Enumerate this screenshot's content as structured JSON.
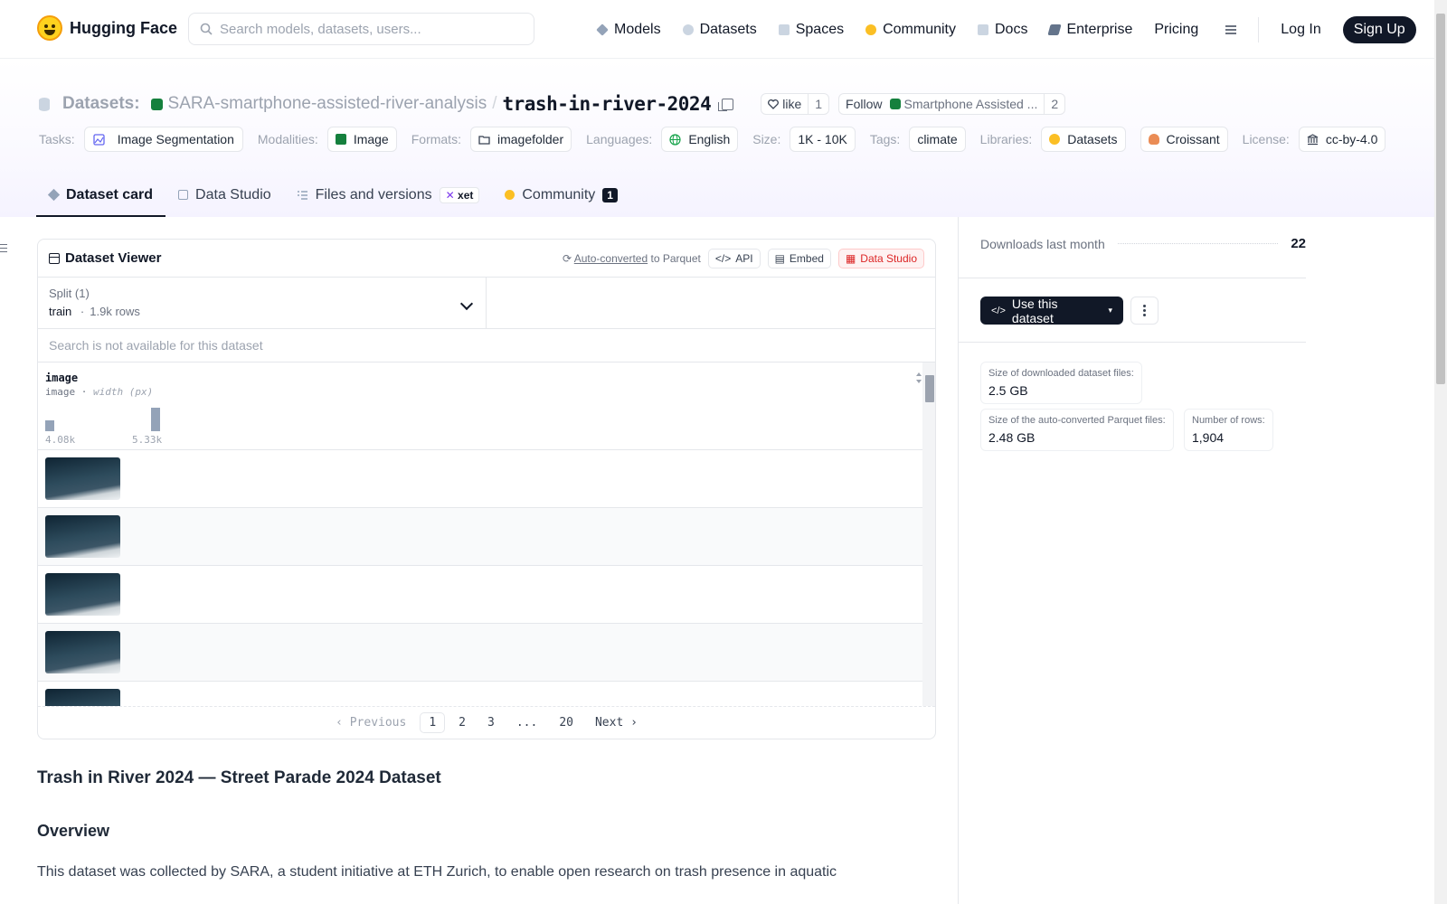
{
  "nav": {
    "brand": "Hugging Face",
    "search_placeholder": "Search models, datasets, users...",
    "links": [
      "Models",
      "Datasets",
      "Spaces",
      "Community",
      "Docs",
      "Enterprise",
      "Pricing"
    ],
    "login": "Log In",
    "signup": "Sign Up"
  },
  "repo": {
    "type_label": "Datasets:",
    "org": "SARA-smartphone-assisted-river-analysis",
    "separator": "/",
    "name": "trash-in-river-2024",
    "like_label": "like",
    "like_count": "1",
    "follow_label": "Follow",
    "follow_org": "Smartphone Assisted ...",
    "follow_count": "2"
  },
  "tags": {
    "tasks_label": "Tasks:",
    "task": "Image Segmentation",
    "modalities_label": "Modalities:",
    "modality": "Image",
    "formats_label": "Formats:",
    "format": "imagefolder",
    "languages_label": "Languages:",
    "language": "English",
    "size_label": "Size:",
    "size": "1K - 10K",
    "tags_label": "Tags:",
    "tag": "climate",
    "libraries_label": "Libraries:",
    "library1": "Datasets",
    "library2": "Croissant",
    "license_label": "License:",
    "license": "cc-by-4.0"
  },
  "tabs": {
    "card": "Dataset card",
    "studio": "Data Studio",
    "files": "Files and versions",
    "xet": "xet",
    "community": "Community",
    "community_count": "1"
  },
  "viewer": {
    "title": "Dataset Viewer",
    "autoconv_link": "Auto-converted",
    "autoconv_rest": "to Parquet",
    "api": "API",
    "embed": "Embed",
    "studio": "Data Studio",
    "split_label": "Split (1)",
    "split_name": "train",
    "split_sep": "·",
    "split_rows": "1.9k rows",
    "search_na": "Search is not available for this dataset",
    "column": {
      "name": "image",
      "type": "image",
      "type_sep": "·",
      "stat": "width (px)",
      "min_label": "4.08k",
      "max_label": "5.33k",
      "bars": [
        0.45,
        1.0
      ]
    },
    "pager": {
      "prev": "Previous",
      "pages": [
        "1",
        "2",
        "3",
        "...",
        "20"
      ],
      "next": "Next"
    }
  },
  "side": {
    "downloads_label": "Downloads last month",
    "downloads": "22",
    "use_button": "Use this dataset",
    "download_size_label": "Size of downloaded dataset files:",
    "download_size": "2.5 GB",
    "parquet_size_label": "Size of the auto-converted Parquet files:",
    "parquet_size": "2.48 GB",
    "rows_label": "Number of rows:",
    "rows": "1,904"
  },
  "card": {
    "title": "Trash in River 2024 — Street Parade 2024 Dataset",
    "overview": "Overview",
    "intro": "This dataset was collected by SARA, a student initiative at ETH Zurich, to enable open research on trash presence in aquatic"
  }
}
